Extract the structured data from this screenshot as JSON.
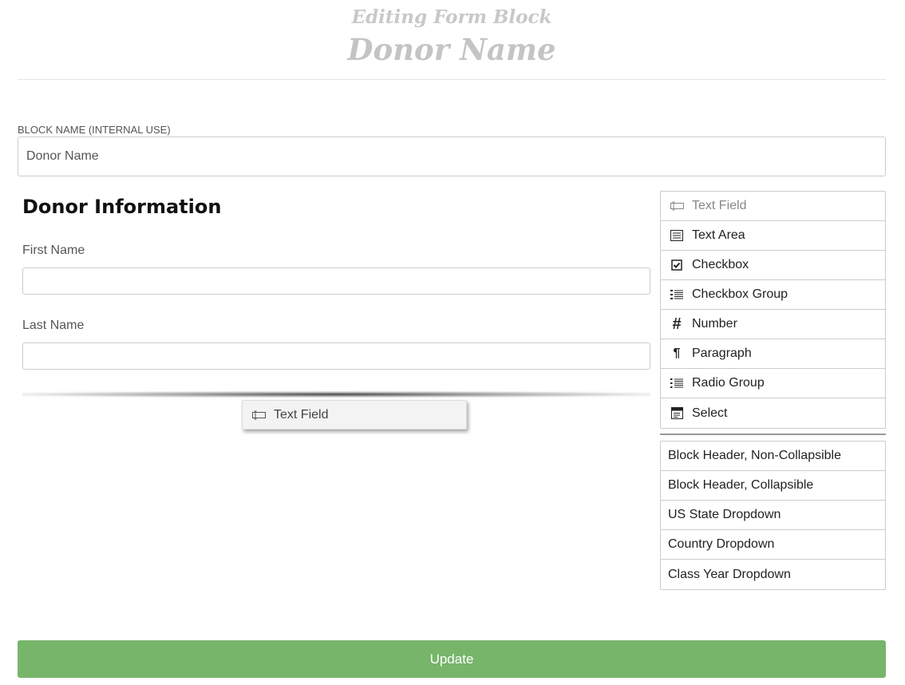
{
  "header": {
    "subtitle": "Editing Form Block",
    "title": "Donor Name"
  },
  "block_name": {
    "label": "BLOCK NAME (INTERNAL USE)",
    "value": "Donor Name"
  },
  "form": {
    "section_title": "Donor Information",
    "fields": [
      {
        "label": "First Name",
        "value": ""
      },
      {
        "label": "Last Name",
        "value": ""
      }
    ],
    "dragging_item": {
      "label": "Text Field",
      "icon": "text-field-icon"
    }
  },
  "palette": {
    "fields": [
      {
        "label": "Text Field",
        "icon": "text-field-icon"
      },
      {
        "label": "Text Area",
        "icon": "text-area-icon"
      },
      {
        "label": "Checkbox",
        "icon": "checkbox-icon"
      },
      {
        "label": "Checkbox Group",
        "icon": "checkbox-group-icon"
      },
      {
        "label": "Number",
        "icon": "hash-icon"
      },
      {
        "label": "Paragraph",
        "icon": "pilcrow-icon"
      },
      {
        "label": "Radio Group",
        "icon": "radio-group-icon"
      },
      {
        "label": "Select",
        "icon": "select-icon"
      }
    ],
    "blocks": [
      "Block Header, Non-Collapsible",
      "Block Header, Collapsible",
      "US State Dropdown",
      "Country Dropdown",
      "Class Year Dropdown"
    ]
  },
  "update_label": "Update",
  "colors": {
    "update_button": "#77b56b"
  }
}
